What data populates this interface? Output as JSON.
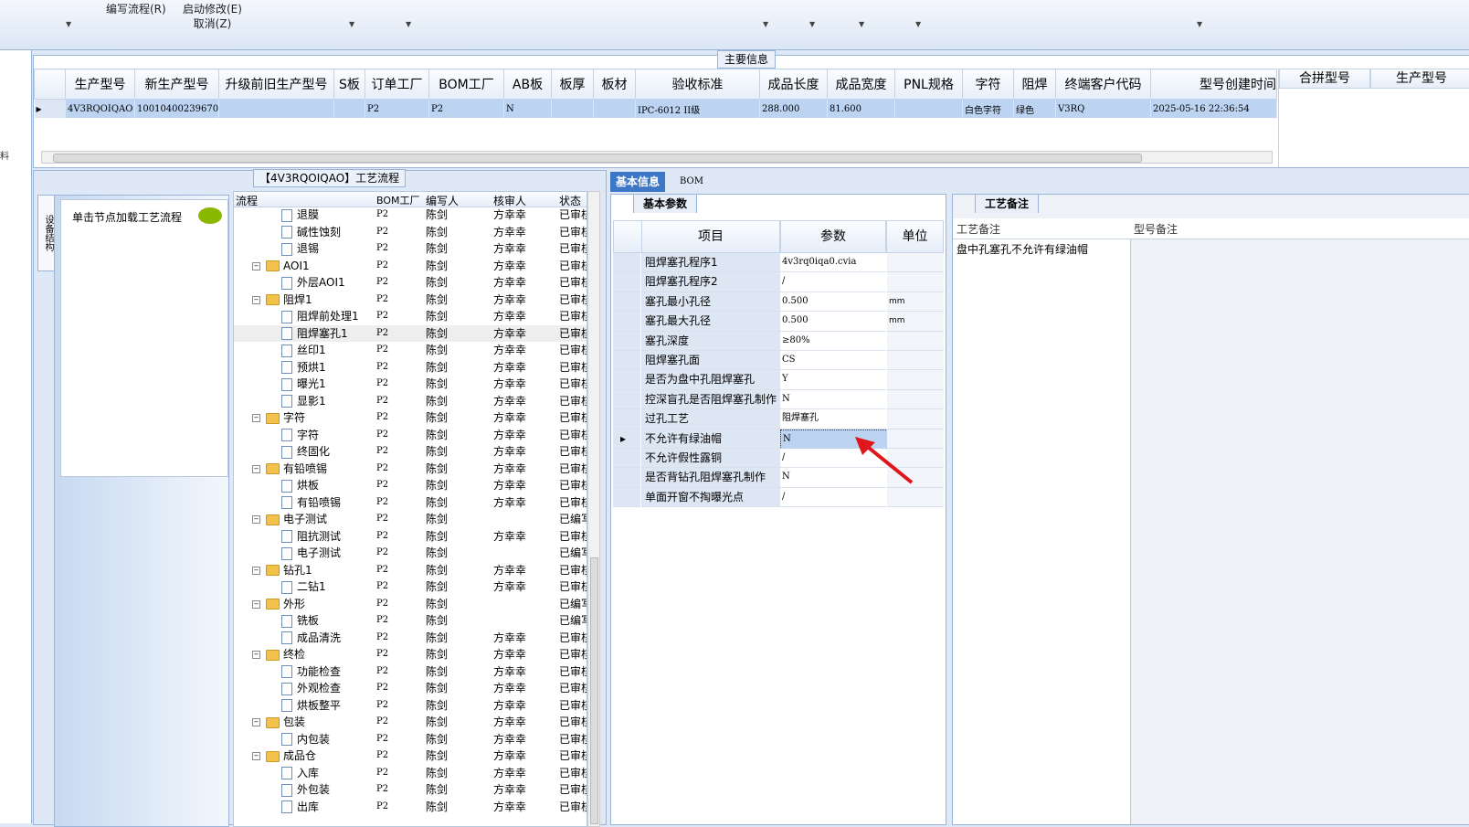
{
  "toolbar": {
    "items": [
      {
        "label": "编写流程(R)"
      },
      {
        "label": "启动修改(E)"
      },
      {
        "label": "取消(Z)"
      }
    ]
  },
  "left_strip": {
    "labels": [
      "料"
    ]
  },
  "main_info": {
    "title": "主要信息",
    "columns": [
      "生产型号",
      "新生产型号",
      "升级前旧生产型号",
      "S板",
      "订单工厂",
      "BOM工厂",
      "AB板",
      "板厚",
      "板材",
      "验收标准",
      "成品长度",
      "成品宽度",
      "PNL规格",
      "字符",
      "阻焊",
      "终端客户代码",
      "型号创建时间"
    ],
    "row": [
      "4V3RQOIQAO",
      "10010400239670",
      "",
      "",
      "P2",
      "P2",
      "N",
      "",
      "",
      "IPC-6012 II级",
      "288.000",
      "81.600",
      "",
      "白色字符",
      "绿色",
      "V3RQ",
      "2025-05-16 22:36:54"
    ],
    "side_columns": [
      "合拼型号",
      "生产型号"
    ]
  },
  "process": {
    "title": "【4V3RQOIQAO】工艺流程",
    "side_tab": "设备结构",
    "hint": "单击节点加载工艺流程",
    "headers": {
      "flow": "流程",
      "bom": "BOM工厂",
      "writer": "编写人",
      "reviewer": "核审人",
      "status": "状态"
    },
    "rows": [
      {
        "level": 2,
        "type": "doc",
        "name": "退膜",
        "bom": "P2",
        "writer": "陈剑",
        "reviewer": "方幸幸",
        "status": "已审核"
      },
      {
        "level": 2,
        "type": "doc",
        "name": "碱性蚀刻",
        "bom": "P2",
        "writer": "陈剑",
        "reviewer": "方幸幸",
        "status": "已审核"
      },
      {
        "level": 2,
        "type": "doc",
        "name": "退锡",
        "bom": "P2",
        "writer": "陈剑",
        "reviewer": "方幸幸",
        "status": "已审核"
      },
      {
        "level": 1,
        "type": "folder",
        "name": "AOI1",
        "bom": "P2",
        "writer": "陈剑",
        "reviewer": "方幸幸",
        "status": "已审核"
      },
      {
        "level": 2,
        "type": "doc",
        "name": "外层AOI1",
        "bom": "P2",
        "writer": "陈剑",
        "reviewer": "方幸幸",
        "status": "已审核"
      },
      {
        "level": 1,
        "type": "folder",
        "name": "阻焊1",
        "bom": "P2",
        "writer": "陈剑",
        "reviewer": "方幸幸",
        "status": "已审核"
      },
      {
        "level": 2,
        "type": "doc",
        "name": "阻焊前处理1",
        "bom": "P2",
        "writer": "陈剑",
        "reviewer": "方幸幸",
        "status": "已审核"
      },
      {
        "level": 2,
        "type": "doc",
        "name": "阻焊塞孔1",
        "bom": "P2",
        "writer": "陈剑",
        "reviewer": "方幸幸",
        "status": "已审核",
        "selected": true
      },
      {
        "level": 2,
        "type": "doc",
        "name": "丝印1",
        "bom": "P2",
        "writer": "陈剑",
        "reviewer": "方幸幸",
        "status": "已审核"
      },
      {
        "level": 2,
        "type": "doc",
        "name": "预烘1",
        "bom": "P2",
        "writer": "陈剑",
        "reviewer": "方幸幸",
        "status": "已审核"
      },
      {
        "level": 2,
        "type": "doc",
        "name": "曝光1",
        "bom": "P2",
        "writer": "陈剑",
        "reviewer": "方幸幸",
        "status": "已审核"
      },
      {
        "level": 2,
        "type": "doc",
        "name": "显影1",
        "bom": "P2",
        "writer": "陈剑",
        "reviewer": "方幸幸",
        "status": "已审核"
      },
      {
        "level": 1,
        "type": "folder",
        "name": "字符",
        "bom": "P2",
        "writer": "陈剑",
        "reviewer": "方幸幸",
        "status": "已审核"
      },
      {
        "level": 2,
        "type": "doc",
        "name": "字符",
        "bom": "P2",
        "writer": "陈剑",
        "reviewer": "方幸幸",
        "status": "已审核"
      },
      {
        "level": 2,
        "type": "doc",
        "name": "终固化",
        "bom": "P2",
        "writer": "陈剑",
        "reviewer": "方幸幸",
        "status": "已审核"
      },
      {
        "level": 1,
        "type": "folder",
        "name": "有铅喷锡",
        "bom": "P2",
        "writer": "陈剑",
        "reviewer": "方幸幸",
        "status": "已审核"
      },
      {
        "level": 2,
        "type": "doc",
        "name": "烘板",
        "bom": "P2",
        "writer": "陈剑",
        "reviewer": "方幸幸",
        "status": "已审核"
      },
      {
        "level": 2,
        "type": "doc",
        "name": "有铅喷锡",
        "bom": "P2",
        "writer": "陈剑",
        "reviewer": "方幸幸",
        "status": "已审核"
      },
      {
        "level": 1,
        "type": "folder",
        "name": "电子测试",
        "bom": "P2",
        "writer": "陈剑",
        "reviewer": "",
        "status": "已编写"
      },
      {
        "level": 2,
        "type": "doc",
        "name": "阻抗测试",
        "bom": "P2",
        "writer": "陈剑",
        "reviewer": "方幸幸",
        "status": "已审核"
      },
      {
        "level": 2,
        "type": "doc",
        "name": "电子测试",
        "bom": "P2",
        "writer": "陈剑",
        "reviewer": "",
        "status": "已编写"
      },
      {
        "level": 1,
        "type": "folder",
        "name": "钻孔1",
        "bom": "P2",
        "writer": "陈剑",
        "reviewer": "方幸幸",
        "status": "已审核"
      },
      {
        "level": 2,
        "type": "doc",
        "name": "二钻1",
        "bom": "P2",
        "writer": "陈剑",
        "reviewer": "方幸幸",
        "status": "已审核"
      },
      {
        "level": 1,
        "type": "folder",
        "name": "外形",
        "bom": "P2",
        "writer": "陈剑",
        "reviewer": "",
        "status": "已编写"
      },
      {
        "level": 2,
        "type": "doc",
        "name": "铣板",
        "bom": "P2",
        "writer": "陈剑",
        "reviewer": "",
        "status": "已编写"
      },
      {
        "level": 2,
        "type": "doc",
        "name": "成品清洗",
        "bom": "P2",
        "writer": "陈剑",
        "reviewer": "方幸幸",
        "status": "已审核"
      },
      {
        "level": 1,
        "type": "folder",
        "name": "终检",
        "bom": "P2",
        "writer": "陈剑",
        "reviewer": "方幸幸",
        "status": "已审核"
      },
      {
        "level": 2,
        "type": "doc",
        "name": "功能检查",
        "bom": "P2",
        "writer": "陈剑",
        "reviewer": "方幸幸",
        "status": "已审核"
      },
      {
        "level": 2,
        "type": "doc",
        "name": "外观检查",
        "bom": "P2",
        "writer": "陈剑",
        "reviewer": "方幸幸",
        "status": "已审核"
      },
      {
        "level": 2,
        "type": "doc",
        "name": "烘板整平",
        "bom": "P2",
        "writer": "陈剑",
        "reviewer": "方幸幸",
        "status": "已审核"
      },
      {
        "level": 1,
        "type": "folder",
        "name": "包装",
        "bom": "P2",
        "writer": "陈剑",
        "reviewer": "方幸幸",
        "status": "已审核"
      },
      {
        "level": 2,
        "type": "doc",
        "name": "内包装",
        "bom": "P2",
        "writer": "陈剑",
        "reviewer": "方幸幸",
        "status": "已审核"
      },
      {
        "level": 1,
        "type": "folder",
        "name": "成品仓",
        "bom": "P2",
        "writer": "陈剑",
        "reviewer": "方幸幸",
        "status": "已审核"
      },
      {
        "level": 2,
        "type": "doc",
        "name": "入库",
        "bom": "P2",
        "writer": "陈剑",
        "reviewer": "方幸幸",
        "status": "已审核"
      },
      {
        "level": 2,
        "type": "doc",
        "name": "外包装",
        "bom": "P2",
        "writer": "陈剑",
        "reviewer": "方幸幸",
        "status": "已审核"
      },
      {
        "level": 2,
        "type": "doc",
        "name": "出库",
        "bom": "P2",
        "writer": "陈剑",
        "reviewer": "方幸幸",
        "status": "已审核"
      }
    ]
  },
  "basic_info": {
    "tabs": [
      "基本信息",
      "BOM"
    ],
    "subtab": "基本参数",
    "headers": [
      "项目",
      "参数",
      "单位"
    ],
    "rows": [
      {
        "item": "阻焊塞孔程序1",
        "value": "4v3rq0iqa0.cvia",
        "unit": ""
      },
      {
        "item": "阻焊塞孔程序2",
        "value": "/",
        "unit": ""
      },
      {
        "item": "塞孔最小孔径",
        "value": "0.500",
        "unit": "mm"
      },
      {
        "item": "塞孔最大孔径",
        "value": "0.500",
        "unit": "mm"
      },
      {
        "item": "塞孔深度",
        "value": "≥80%",
        "unit": ""
      },
      {
        "item": "阻焊塞孔面",
        "value": "CS",
        "unit": ""
      },
      {
        "item": "是否为盘中孔阻焊塞孔",
        "value": "Y",
        "unit": ""
      },
      {
        "item": "控深盲孔是否阻焊塞孔制作",
        "value": "N",
        "unit": ""
      },
      {
        "item": "过孔工艺",
        "value": "阻焊塞孔",
        "unit": ""
      },
      {
        "item": "不允许有绿油帽",
        "value": "N",
        "unit": "",
        "current": true
      },
      {
        "item": "不允许假性露铜",
        "value": "/",
        "unit": ""
      },
      {
        "item": "是否背钻孔阻焊塞孔制作",
        "value": "N",
        "unit": ""
      },
      {
        "item": "单面开窗不掏曝光点",
        "value": "/",
        "unit": ""
      }
    ]
  },
  "notes": {
    "tab": "工艺备注",
    "col1": "工艺备注",
    "col2": "型号备注",
    "text": "盘中孔塞孔不允许有绿油帽"
  },
  "colors": {
    "accent": "#3c78c6",
    "selection": "#bcd4f2",
    "arrow": "#e0161c",
    "folder": "#f3c24a"
  }
}
